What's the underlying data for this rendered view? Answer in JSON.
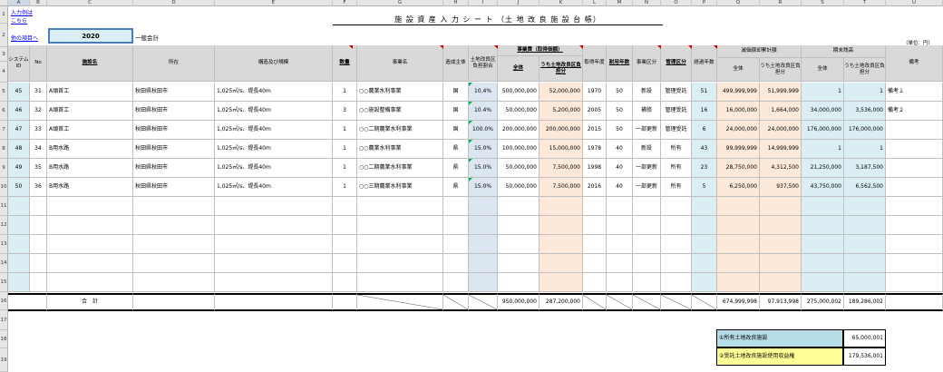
{
  "columns": [
    "A",
    "B",
    "C",
    "D",
    "E",
    "F",
    "G",
    "H",
    "I",
    "J",
    "K",
    "L",
    "M",
    "N",
    "O",
    "P",
    "Q",
    "R",
    "S",
    "T",
    "U"
  ],
  "rows_visible": [
    "1",
    "2",
    "3",
    "4",
    "5",
    "6",
    "7",
    "8",
    "9",
    "10",
    "11",
    "12",
    "13",
    "14",
    "15",
    "16",
    "17",
    "18",
    "19"
  ],
  "links": {
    "input_example_1": "入力例は",
    "input_example_2": "こちら",
    "other_items": "他の項目へ"
  },
  "year": "2020",
  "account": "一般会計",
  "title": "施 設 資 産 入 力 シ ー ト （土 地 改 良 施 設 台 帳）",
  "unit": "（単位：円）",
  "headers": {
    "system_id": "システムID",
    "no": "No",
    "facility_name": "施設名",
    "location": "所在",
    "structure": "構造及び規模",
    "quantity": "数量",
    "project_name": "事業名",
    "builder": "造成主体",
    "burden_ratio": "土地改良区負担割合",
    "project_cost": "事業費（取得価額）",
    "total": "全体",
    "of_which": "うち土地改良区負担分",
    "acquired_year": "取得年度",
    "useful_life": "耐用年数",
    "project_class": "事業区分",
    "mgmt_class": "管理区分",
    "elapsed_years": "経過年数",
    "accum_depreciation": "減価償却累計額",
    "ending_balance": "期末残高",
    "remarks": "備考"
  },
  "data_rows": [
    {
      "id": "45",
      "no": "31",
      "name": "A頭首工",
      "loc": "秋田県秋田市",
      "struct": "1,025㎥/s、堤長40m",
      "qty": "1",
      "project": "○○農業水利事業",
      "builder": "国",
      "ratio": "10.4%",
      "total": "500,000,000",
      "share": "52,000,000",
      "year": "1970",
      "life": "50",
      "pclass": "新設",
      "mclass": "管理受託",
      "elapsed": "51",
      "dep_total": "499,999,999",
      "dep_share": "51,999,999",
      "end_total": "1",
      "end_share": "1",
      "remark": "備考１"
    },
    {
      "id": "46",
      "no": "32",
      "name": "A頭首工",
      "loc": "秋田県秋田市",
      "struct": "1,025㎥/s、堤長40m",
      "qty": "3",
      "project": "○○施設整備事業",
      "builder": "国",
      "ratio": "10.4%",
      "total": "50,000,000",
      "share": "5,200,000",
      "year": "2005",
      "life": "50",
      "pclass": "補修",
      "mclass": "管理受託",
      "elapsed": "16",
      "dep_total": "16,000,000",
      "dep_share": "1,664,000",
      "end_total": "34,000,000",
      "end_share": "3,536,000",
      "remark": "備考２"
    },
    {
      "id": "47",
      "no": "33",
      "name": "A頭首工",
      "loc": "秋田県秋田市",
      "struct": "1,025㎥/s、堤長40m",
      "qty": "1",
      "project": "○○二期農業水利事業",
      "builder": "国",
      "ratio": "100.0%",
      "total": "200,000,000",
      "share": "200,000,000",
      "year": "2015",
      "life": "50",
      "pclass": "一部更新",
      "mclass": "管理受託",
      "elapsed": "6",
      "dep_total": "24,000,000",
      "dep_share": "24,000,000",
      "end_total": "176,000,000",
      "end_share": "176,000,000",
      "remark": ""
    },
    {
      "id": "48",
      "no": "34",
      "name": "B用水路",
      "loc": "秋田県秋田市",
      "struct": "1,025㎥/s、堤長40m",
      "qty": "1",
      "project": "○○農業水利事業",
      "builder": "県",
      "ratio": "15.0%",
      "total": "100,000,000",
      "share": "15,000,000",
      "year": "1978",
      "life": "40",
      "pclass": "新設",
      "mclass": "所有",
      "elapsed": "43",
      "dep_total": "99,999,999",
      "dep_share": "14,999,999",
      "end_total": "1",
      "end_share": "1",
      "remark": ""
    },
    {
      "id": "49",
      "no": "35",
      "name": "B用水路",
      "loc": "秋田県秋田市",
      "struct": "1,025㎥/s、堤長40m",
      "qty": "1",
      "project": "○○二期農業水利事業",
      "builder": "県",
      "ratio": "15.0%",
      "total": "50,000,000",
      "share": "7,500,000",
      "year": "1998",
      "life": "40",
      "pclass": "一部更新",
      "mclass": "所有",
      "elapsed": "23",
      "dep_total": "28,750,000",
      "dep_share": "4,312,500",
      "end_total": "21,250,000",
      "end_share": "3,187,500",
      "remark": ""
    },
    {
      "id": "50",
      "no": "36",
      "name": "B用水路",
      "loc": "秋田県秋田市",
      "struct": "1,025㎥/s、堤長40m",
      "qty": "1",
      "project": "○○三期農業水利事業",
      "builder": "県",
      "ratio": "15.0%",
      "total": "50,000,000",
      "share": "7,500,000",
      "year": "2016",
      "life": "40",
      "pclass": "一部更新",
      "mclass": "所有",
      "elapsed": "5",
      "dep_total": "6,250,000",
      "dep_share": "937,500",
      "end_total": "43,750,000",
      "end_share": "6,562,500",
      "remark": ""
    }
  ],
  "totals": {
    "label": "合　計",
    "total": "950,000,000",
    "share": "287,200,000",
    "dep_total": "674,999,998",
    "dep_share": "97,913,998",
    "end_total": "275,000,002",
    "end_share": "189,286,002"
  },
  "summary": [
    {
      "label": "①所有土地改良施設",
      "value": "65,000,001"
    },
    {
      "label": "②受託土地改良施設使用収益権",
      "value": "179,536,001"
    }
  ]
}
